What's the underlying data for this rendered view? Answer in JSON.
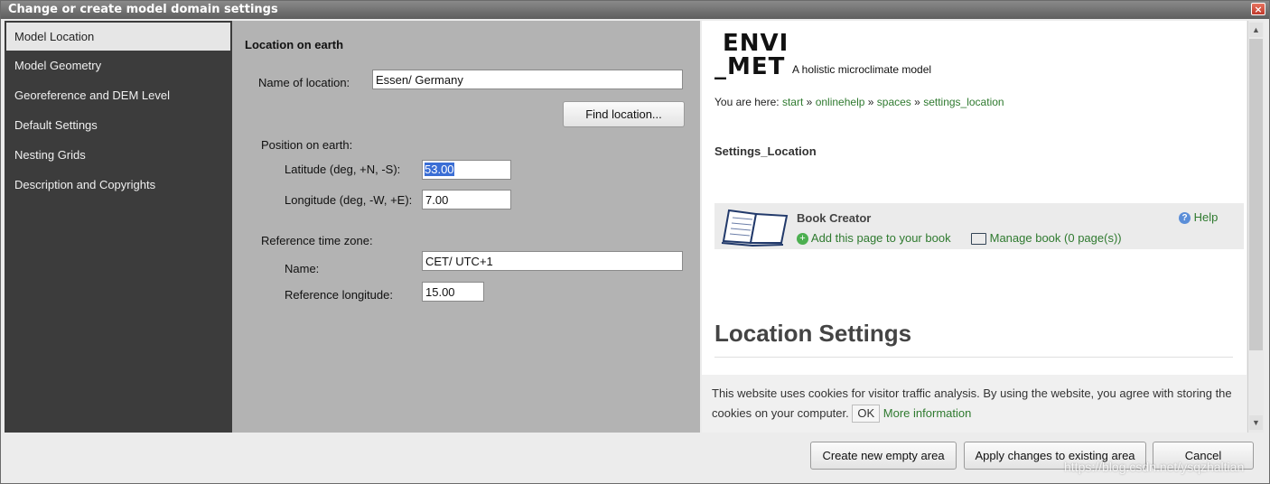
{
  "window": {
    "title": "Change or create model domain settings",
    "close_icon": "×"
  },
  "sidebar": {
    "items": [
      {
        "label": "Model Location"
      },
      {
        "label": "Model Geometry"
      },
      {
        "label": "Georeference and DEM Level"
      },
      {
        "label": "Default Settings"
      },
      {
        "label": "Nesting Grids"
      },
      {
        "label": "Description and Copyrights"
      }
    ],
    "active_index": 0
  },
  "form": {
    "section_title": "Location on earth",
    "name_label": "Name of location:",
    "name_value": "Essen/ Germany",
    "find_button": "Find location...",
    "position_title": "Position on earth:",
    "latitude_label": "Latitude (deg, +N, -S):",
    "latitude_value": "53.00",
    "longitude_label": "Longitude (deg, -W, +E):",
    "longitude_value": "7.00",
    "timezone_title": "Reference time zone:",
    "tz_name_label": "Name:",
    "tz_name_value": "CET/ UTC+1",
    "ref_lon_label": "Reference longitude:",
    "ref_lon_value": "15.00"
  },
  "help": {
    "logo_line1": "ENVI",
    "logo_line2": "_MET",
    "tagline": "A holistic microclimate model",
    "breadcrumb_prefix": "You are here:",
    "breadcrumb": [
      "start",
      "onlinehelp",
      "spaces",
      "settings_location"
    ],
    "breadcrumb_separator": "»",
    "page_heading": "Settings_Location",
    "book_creator_title": "Book Creator",
    "add_page_link": "Add this page to your book",
    "manage_book_link": "Manage book (0 page(s))",
    "help_link": "Help",
    "location_title": "Location Settings",
    "cookie_text": "This website uses cookies for visitor traffic analysis. By using the website, you agree with storing the cookies on your computer.",
    "cookie_ok": "OK",
    "cookie_more": "More information"
  },
  "footer": {
    "create_button": "Create new empty area",
    "apply_button": "Apply changes to existing area",
    "cancel_button": "Cancel"
  },
  "watermark": "https://blog.csdn.net/ysqzhaltian",
  "colors": {
    "sidebar_bg": "#3c3c3c",
    "form_bg": "#b3b3b3",
    "link_green": "#2f7a2f",
    "selection_blue": "#3b6ed5"
  }
}
